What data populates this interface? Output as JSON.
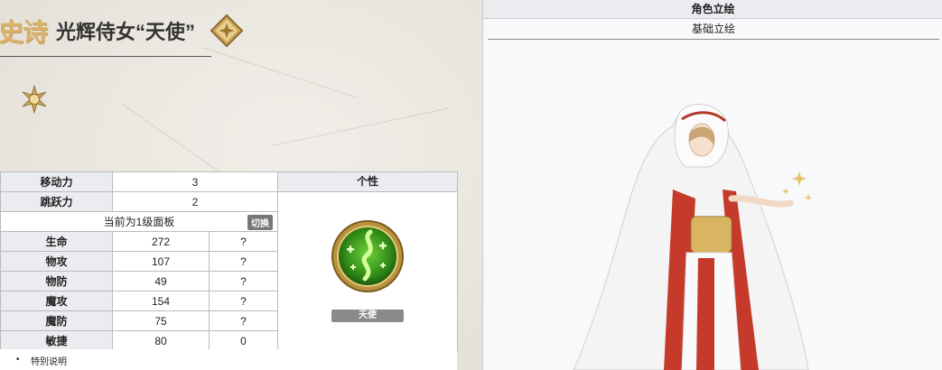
{
  "header": {
    "rarity": "史诗",
    "name": "光辉侍女“天使”"
  },
  "stats": {
    "move_label": "移动力",
    "move_value": "3",
    "jump_label": "跳跃力",
    "jump_value": "2",
    "panel_text": "当前为1级面板",
    "switch_label": "切换",
    "rows": [
      {
        "label": "生命",
        "value": "272",
        "extra": "?"
      },
      {
        "label": "物攻",
        "value": "107",
        "extra": "?"
      },
      {
        "label": "物防",
        "value": "49",
        "extra": "?"
      },
      {
        "label": "魔攻",
        "value": "154",
        "extra": "?"
      },
      {
        "label": "魔防",
        "value": "75",
        "extra": "?"
      },
      {
        "label": "敏捷",
        "value": "80",
        "extra": "0"
      }
    ]
  },
  "personality": {
    "header": "个性",
    "skill_name": "天使"
  },
  "note": {
    "text": "特别说明"
  },
  "portrait_panel": {
    "title": "角色立绘",
    "tab": "基础立绘"
  },
  "icons": {
    "class": "gold-diamond-class-icon",
    "sun": "gold-sun-icon",
    "skill": "green-heal-skill-icon"
  },
  "colors": {
    "rarity_gold": "#d7b16b",
    "header_bg": "#eaecf0",
    "skill_green": "#3f9a1e"
  }
}
